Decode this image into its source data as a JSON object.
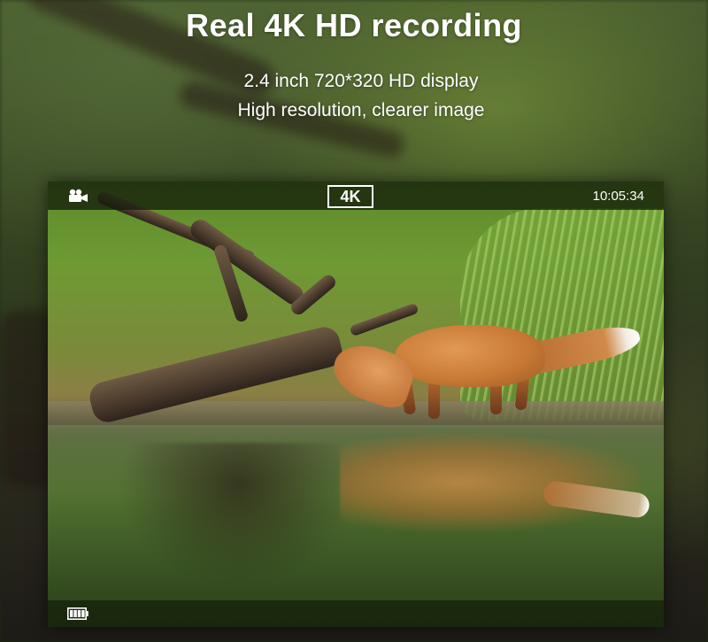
{
  "headline": "Real 4K HD recording",
  "subtitle_line1": "2.4 inch 720*320 HD display",
  "subtitle_line2": "High resolution, clearer image",
  "display": {
    "mode_icon": "video-camera-icon",
    "resolution_badge": "4K",
    "time": "10:05:34",
    "battery_icon": "battery-icon",
    "battery_level": 1.0
  },
  "colors": {
    "text": "#ffffff",
    "hud_bar": "#141e0a"
  }
}
